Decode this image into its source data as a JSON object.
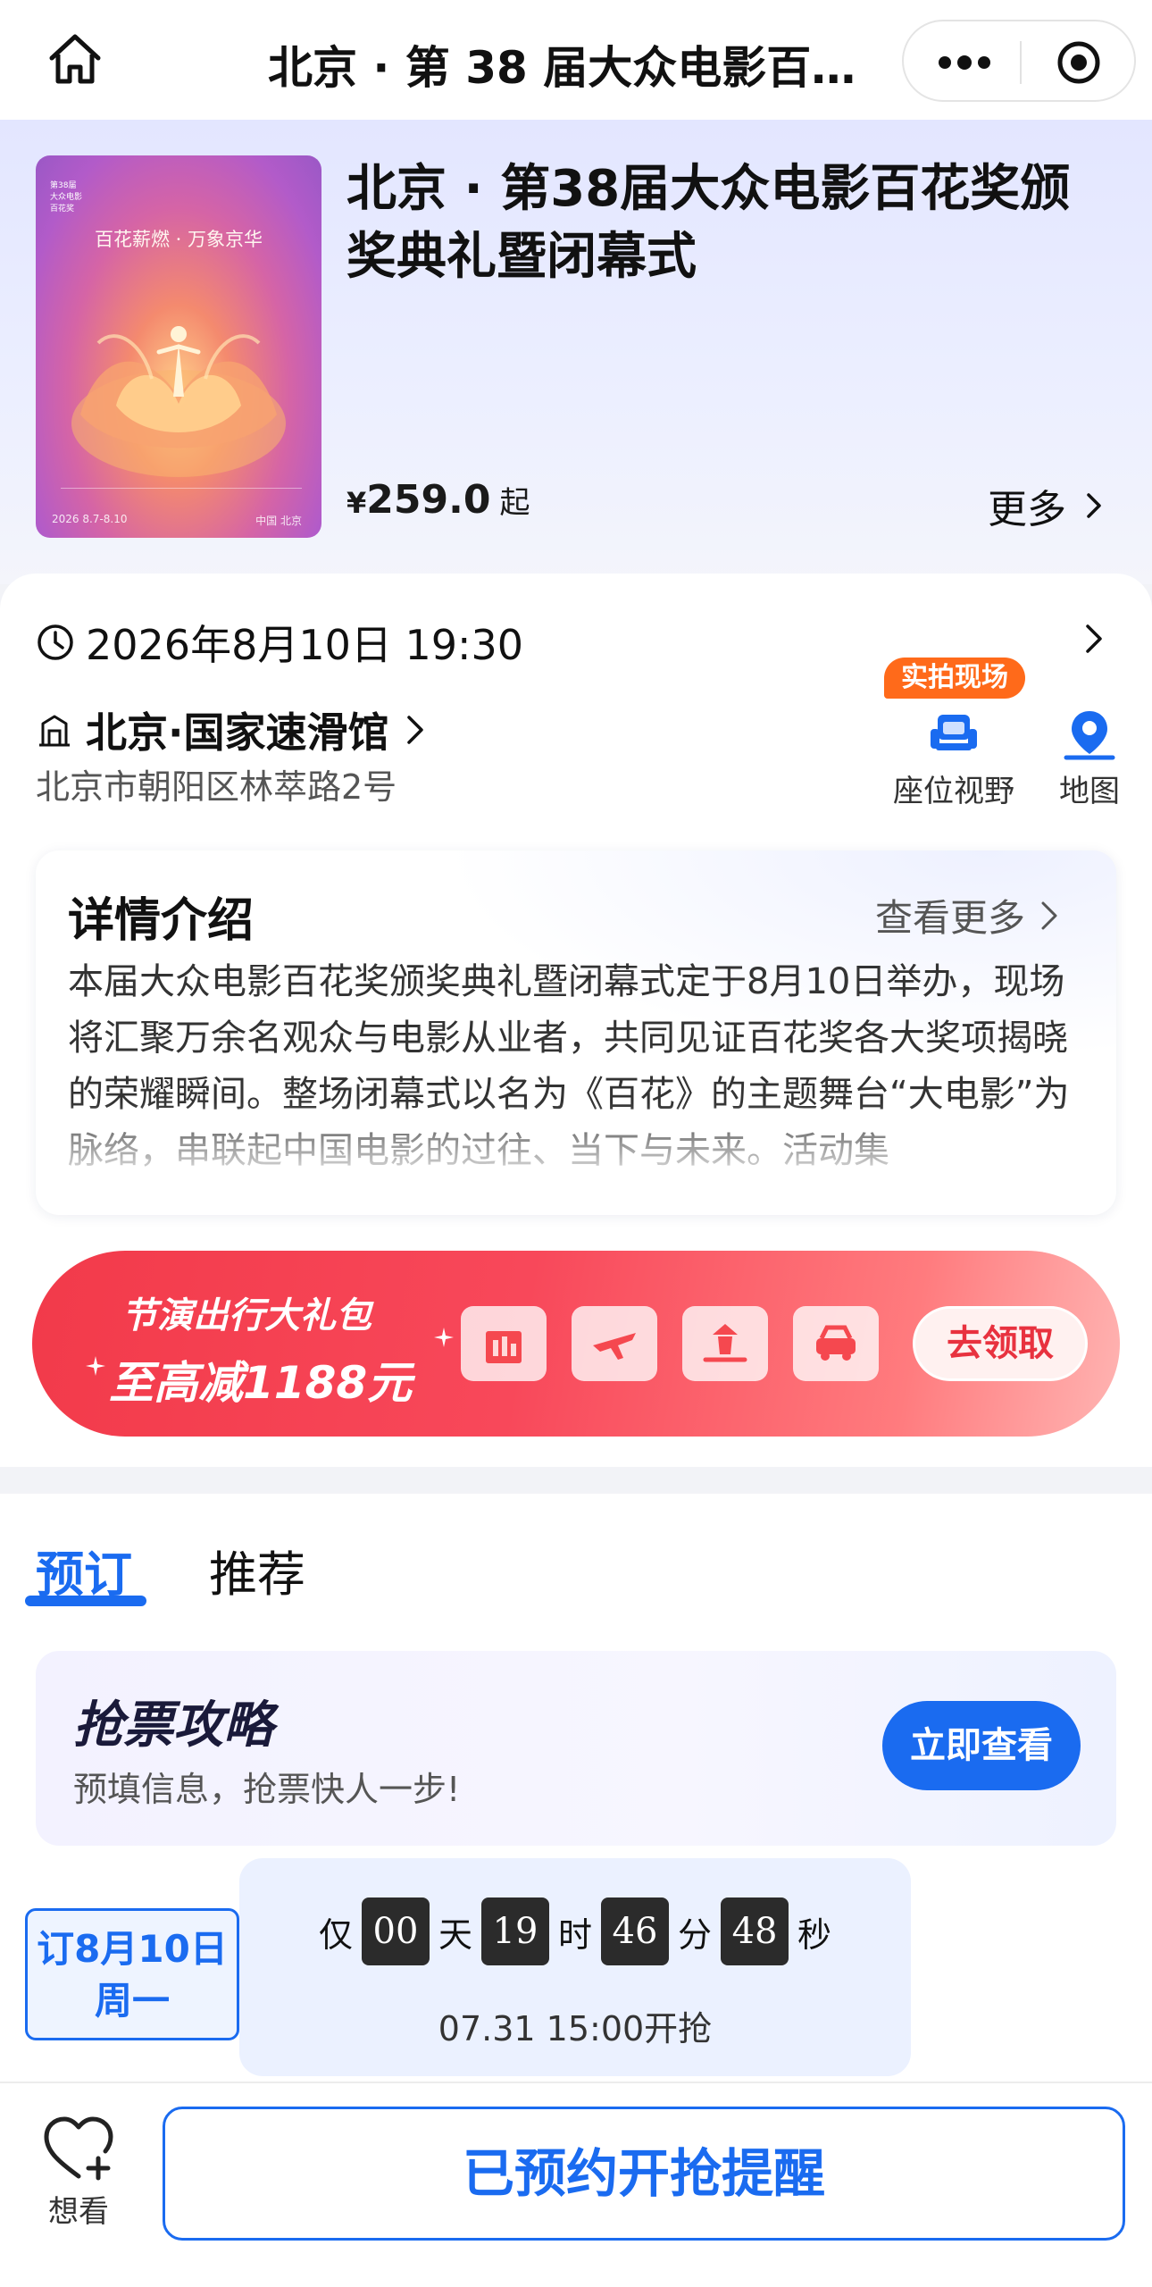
{
  "navbar": {
    "title": "北京 · 第 38 届大众电影百花..."
  },
  "hero": {
    "title": "北京 · 第38届大众电影百花奖颁奖典礼暨闭幕式",
    "currency": "¥",
    "price": "259.0",
    "price_suffix": "起",
    "more_label": "更多",
    "poster": {
      "slogan": "百花薪燃 · 万象京华",
      "tag": "第38届 大众电影 百花奖",
      "foot_left": "2026 8.7-8.10",
      "foot_right": "中国 北京"
    }
  },
  "info": {
    "datetime": "2026年8月10日 19:30",
    "venue": "北京·国家速滑馆",
    "address": "北京市朝阳区林萃路2号",
    "live_badge": "实拍现场",
    "seat_view_label": "座位视野",
    "map_label": "地图"
  },
  "detail": {
    "title": "详情介绍",
    "more_label": "查看更多",
    "body": "本届大众电影百花奖颁奖典礼暨闭幕式定于8月10日举办，现场将汇聚万余名观众与电影从业者，共同见证百花奖各大奖项揭晓的荣耀瞬间。整场闭幕式以名为《百花》的主题舞台“大电影”为脉络，串联起中国电影的过往、当下与未来。活动集"
  },
  "promo": {
    "line1": "节演出行大礼包",
    "line2": "至高减1188元",
    "claim_label": "去领取",
    "tiles": [
      "hotel-icon",
      "plane-icon",
      "scenic-icon",
      "car-icon"
    ]
  },
  "booking": {
    "tab_book": "预订",
    "tab_recommend": "推荐",
    "strategy_title": "抢票攻略",
    "strategy_sub": "预填信息，抢票快人一步!",
    "strategy_button": "立即查看",
    "date_chip_line1": "订8月10日",
    "date_chip_line2": "周一"
  },
  "countdown": {
    "prefix": "仅",
    "days": "00",
    "days_unit": "天",
    "hours": "19",
    "hours_unit": "时",
    "minutes": "46",
    "minutes_unit": "分",
    "seconds": "48",
    "seconds_unit": "秒",
    "open_time": "07.31 15:00开抢"
  },
  "bottombar": {
    "wish_label": "想看",
    "remind_label": "已预约开抢提醒"
  },
  "colors": {
    "accent": "#1a6bf0",
    "badge": "#ff6a1a",
    "promo": "#f23a4a"
  }
}
